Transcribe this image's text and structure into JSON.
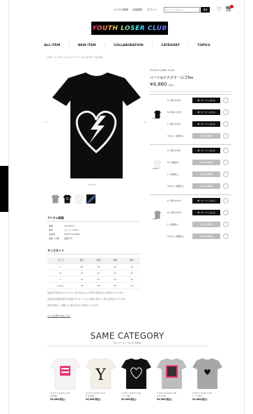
{
  "topbar": {
    "links": [
      "メルマガ登録",
      "会員登録",
      "ログイン"
    ],
    "search_placeholder": "キーワードを入力",
    "search_button": "検索",
    "cart_count": ""
  },
  "logo": {
    "text": "YOUTH LOSER CLUB"
  },
  "nav": {
    "items": [
      "ALL ITEM",
      "NEW ITEM",
      "COLLABORATION",
      "CATEGORY",
      "TOPICS"
    ]
  },
  "breadcrumb": "TOP > トップス > Tシャツ > ハート&イナズマ・ロゴTee",
  "product": {
    "brand": "YOUTH LOSER CLUB",
    "name": "ハート&イナズマ・ロゴTee",
    "price": "¥4,860",
    "tax": "(税込)",
    "image_caption": "BLACK",
    "thumbs": [
      "gray",
      "black",
      "white",
      "black-print"
    ]
  },
  "variants": [
    {
      "color_label": "BLACK",
      "swatch": "black",
      "sizes": [
        {
          "size": "S / 残りわずか",
          "button": "カートへ入れる",
          "available": true
        },
        {
          "size": "M / 残りわずか",
          "button": "カートへ入れる",
          "available": true
        },
        {
          "size": "L / 残りわずか",
          "button": "カートへ入れる",
          "available": true
        },
        {
          "size": "XL(LL) / 在庫なし",
          "button": "再入荷通知",
          "available": false
        }
      ]
    },
    {
      "color_label": "WHITE",
      "swatch": "white",
      "sizes": [
        {
          "size": "S / 残りわずか",
          "button": "カートへ入れる",
          "available": true
        },
        {
          "size": "M / 在庫なし",
          "button": "再入荷通知",
          "available": false
        },
        {
          "size": "L / 在庫なし",
          "button": "再入荷通知",
          "available": false
        },
        {
          "size": "XL(LL) / 在庫なし",
          "button": "再入荷通知",
          "available": false
        }
      ]
    },
    {
      "color_label": "GRAY",
      "swatch": "gray",
      "sizes": [
        {
          "size": "S / 残りわずか",
          "button": "カートへ入れる",
          "available": true
        },
        {
          "size": "M / 残りわずか",
          "button": "カートへ入れる",
          "available": true
        },
        {
          "size": "L / 在庫なし",
          "button": "再入荷通知",
          "available": false
        },
        {
          "size": "XL(LL) / 在庫なし",
          "button": "再入荷通知",
          "available": false
        }
      ]
    }
  ],
  "item_detail": {
    "title": "アイテム詳細",
    "rows": [
      {
        "k": "品番",
        "v": "YLC0021T"
      },
      {
        "k": "素材",
        "v": "コットン100%"
      },
      {
        "k": "生産国",
        "v": "MADE IN JAPAN"
      },
      {
        "k": "返品・交換",
        "v": "返品不可"
      }
    ]
  },
  "size_guide": {
    "title": "サイズガイド",
    "headers": [
      "サイズ",
      "着丈",
      "身幅",
      "肩幅",
      "袖丈"
    ],
    "rows": [
      [
        "S",
        "66",
        "49",
        "44",
        "19"
      ],
      [
        "M",
        "70",
        "52",
        "47",
        "20"
      ],
      [
        "L",
        "74",
        "55",
        "50",
        "21"
      ],
      [
        "XL(LL)",
        "78",
        "58",
        "53",
        "22"
      ]
    ],
    "notes": [
      "商品の平置き採寸サイズです。採寸方法によって若干の誤差が生じる場合がございます。",
      "商品の色は撮影環境やお客様のモニターによって実物と異なって見える場合がございます。",
      "素材の特性上、洗濯により縮みが生じる場合がございます。"
    ],
    "link": "サイズの測り方はこちら"
  },
  "same_category": {
    "title": "SAME CATEGORY",
    "subtitle": "同じカテゴリーの人気の商品",
    "items": [
      {
        "brand": "YOUTH LOSER CLUB",
        "name": "ロゴTee",
        "price": "¥4,860(税込)",
        "art": "white-pink"
      },
      {
        "brand": "YOUTH LOSER CLUB",
        "name": "Y ロゴTee",
        "price": "¥4,860(税込)",
        "art": "cream-y"
      },
      {
        "brand": "YOUTH LOSER CLUB",
        "name": "ハートTee",
        "price": "¥4,860(税込)",
        "art": "black-heart"
      },
      {
        "brand": "YOUTH LOSER CLUB",
        "name": "フォトTee",
        "price": "¥4,860(税込)",
        "art": "gray-photo"
      },
      {
        "brand": "YOUTH LOSER CLUB",
        "name": "ハートTee",
        "price": "¥4,860(税込)",
        "art": "gray-heart"
      }
    ]
  }
}
